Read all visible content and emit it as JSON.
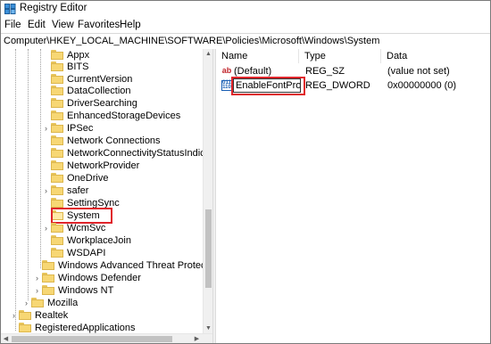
{
  "window": {
    "title": "Registry Editor"
  },
  "menu": [
    "File",
    "Edit",
    "View",
    "Favorites",
    "Help"
  ],
  "address": "Computer\\HKEY_LOCAL_MACHINE\\SOFTWARE\\Policies\\Microsoft\\Windows\\System",
  "tree": {
    "items": [
      {
        "label": "Appx"
      },
      {
        "label": "BITS"
      },
      {
        "label": "CurrentVersion"
      },
      {
        "label": "DataCollection"
      },
      {
        "label": "DriverSearching"
      },
      {
        "label": "EnhancedStorageDevices"
      },
      {
        "label": "IPSec"
      },
      {
        "label": "Network Connections"
      },
      {
        "label": "NetworkConnectivityStatusIndicator"
      },
      {
        "label": "NetworkProvider"
      },
      {
        "label": "OneDrive"
      },
      {
        "label": "safer"
      },
      {
        "label": "SettingSync"
      },
      {
        "label": "System"
      },
      {
        "label": "WcmSvc"
      },
      {
        "label": "WorkplaceJoin"
      },
      {
        "label": "WSDAPI"
      },
      {
        "label": "Windows Advanced Threat Protection"
      },
      {
        "label": "Windows Defender"
      },
      {
        "label": "Windows NT"
      },
      {
        "label": "Mozilla"
      },
      {
        "label": "Realtek"
      },
      {
        "label": "RegisteredApplications"
      }
    ]
  },
  "list": {
    "columns": [
      "Name",
      "Type",
      "Data"
    ],
    "rows": [
      {
        "name": "(Default)",
        "type": "REG_SZ",
        "data": "(value not set)",
        "icon": "string-value-icon"
      },
      {
        "name": "EnableFontProvi...",
        "type": "REG_DWORD",
        "data": "0x00000000 (0)",
        "icon": "dword-value-icon"
      }
    ]
  },
  "colors": {
    "highlight": "#e0252b",
    "folder": "#f7d774"
  }
}
